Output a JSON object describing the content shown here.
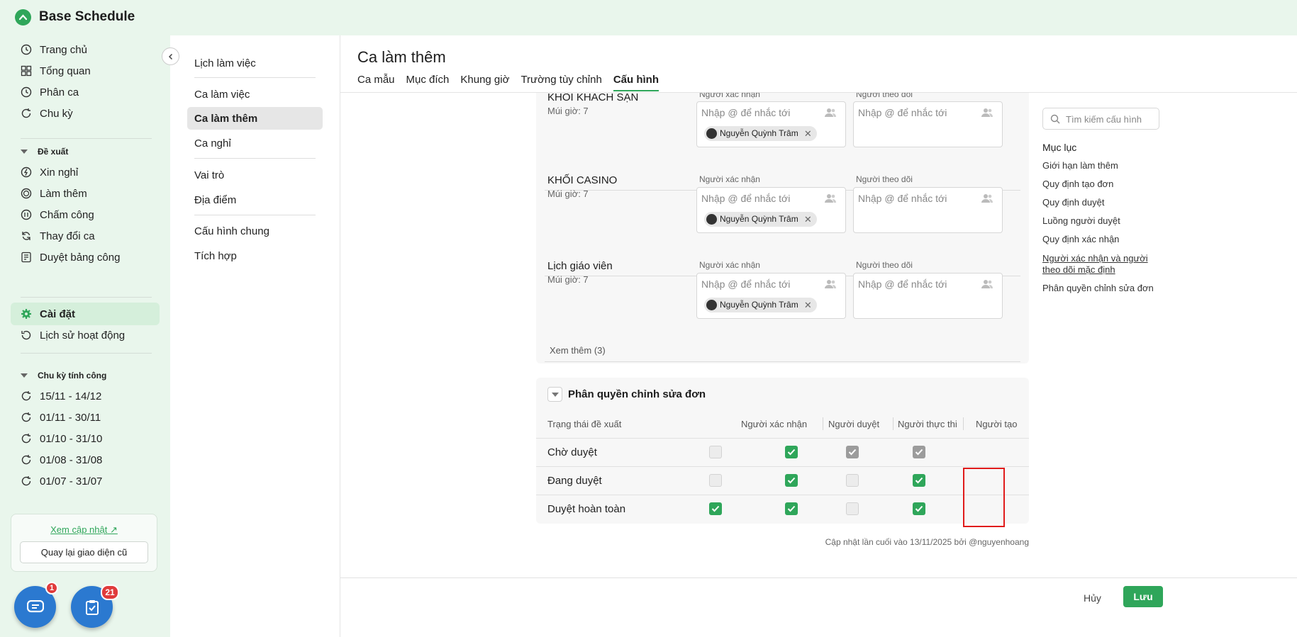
{
  "app": {
    "title": "Base Schedule"
  },
  "sidebar": {
    "items": [
      {
        "label": "Trang chủ",
        "icon": "clock-icon"
      },
      {
        "label": "Tổng quan",
        "icon": "grid-icon"
      },
      {
        "label": "Phân ca",
        "icon": "clock-icon"
      },
      {
        "label": "Chu kỳ",
        "icon": "refresh-icon"
      }
    ],
    "proposals_heading": "Đề xuất",
    "proposal_items": [
      {
        "label": "Xin nghỉ",
        "icon": "leave-icon"
      },
      {
        "label": "Làm thêm",
        "icon": "overtime-icon"
      },
      {
        "label": "Chấm công",
        "icon": "timesheet-icon"
      },
      {
        "label": "Thay đổi ca",
        "icon": "swap-icon"
      },
      {
        "label": "Duyệt bảng công",
        "icon": "approve-sheet-icon"
      }
    ],
    "settings_label": "Cài đặt",
    "history_label": "Lịch sử hoạt động",
    "cycles_heading": "Chu kỳ tính công",
    "cycles": [
      "15/11 - 14/12",
      "01/11 - 30/11",
      "01/10 - 31/10",
      "01/08 - 31/08",
      "01/07 - 31/07"
    ],
    "update_link": "Xem cập nhật",
    "old_ui_button": "Quay lại giao diện cũ",
    "chat_badge": "1",
    "tasks_badge": "21"
  },
  "subnav": {
    "items": [
      "Lịch làm việc",
      "Ca làm việc",
      "Ca làm thêm",
      "Ca nghỉ",
      "Vai trò",
      "Địa điểm",
      "Cấu hình chung",
      "Tích hợp"
    ],
    "active": "Ca làm thêm"
  },
  "main": {
    "title": "Ca làm thêm",
    "tabs": [
      "Ca mẫu",
      "Mục đích",
      "Khung giờ",
      "Trường tùy chỉnh",
      "Cấu hình"
    ],
    "active_tab": "Cấu hình",
    "approver_label": "Người xác nhận",
    "follower_label": "Người theo dõi",
    "field_placeholder": "Nhập @ để nhắc tới",
    "groups": [
      {
        "name": "KHỐI KHÁCH SẠN",
        "timezone": "Múi giờ: 7",
        "approver": "Nguyễn Quỳnh Trâm"
      },
      {
        "name": "KHỐI CASINO",
        "timezone": "Múi giờ: 7",
        "approver": "Nguyễn Quỳnh Trâm"
      },
      {
        "name": "Lịch giáo viên",
        "timezone": "Múi giờ: 7",
        "approver": "Nguyễn Quỳnh Trâm"
      }
    ],
    "see_more": "Xem thêm (3)",
    "permissions": {
      "title": "Phân quyền chỉnh sửa đơn",
      "columns": [
        "Trạng thái đề xuất",
        "Người xác nhận",
        "Người duyệt",
        "Người thực thi",
        "Người tạo"
      ],
      "rows": [
        {
          "status": "Chờ duyệt",
          "states": [
            "off",
            "on",
            "dis-on",
            "dis-on"
          ]
        },
        {
          "status": "Đang duyệt",
          "states": [
            "off",
            "on",
            "off",
            "on"
          ]
        },
        {
          "status": "Duyệt hoàn toàn",
          "states": [
            "on",
            "on",
            "off",
            "on"
          ]
        }
      ]
    },
    "last_updated": "Cập nhật lần cuối vào 13/11/2025 bởi @nguyenhoang",
    "cancel_button": "Hủy",
    "save_button": "Lưu"
  },
  "toc": {
    "search_placeholder": "Tìm kiếm cấu hình",
    "title": "Mục lục",
    "items": [
      "Giới hạn làm thêm",
      "Quy định tạo đơn",
      "Quy định duyệt",
      "Luồng người duyệt",
      "Quy định xác nhận",
      "Người xác nhận và người theo dõi mặc định",
      "Phân quyền chỉnh sửa đơn"
    ],
    "current": "Người xác nhận và người theo dõi mặc định"
  },
  "colors": {
    "accent": "#2fa65a",
    "highlight": "#e01b1b",
    "fab": "#2b79d0"
  }
}
